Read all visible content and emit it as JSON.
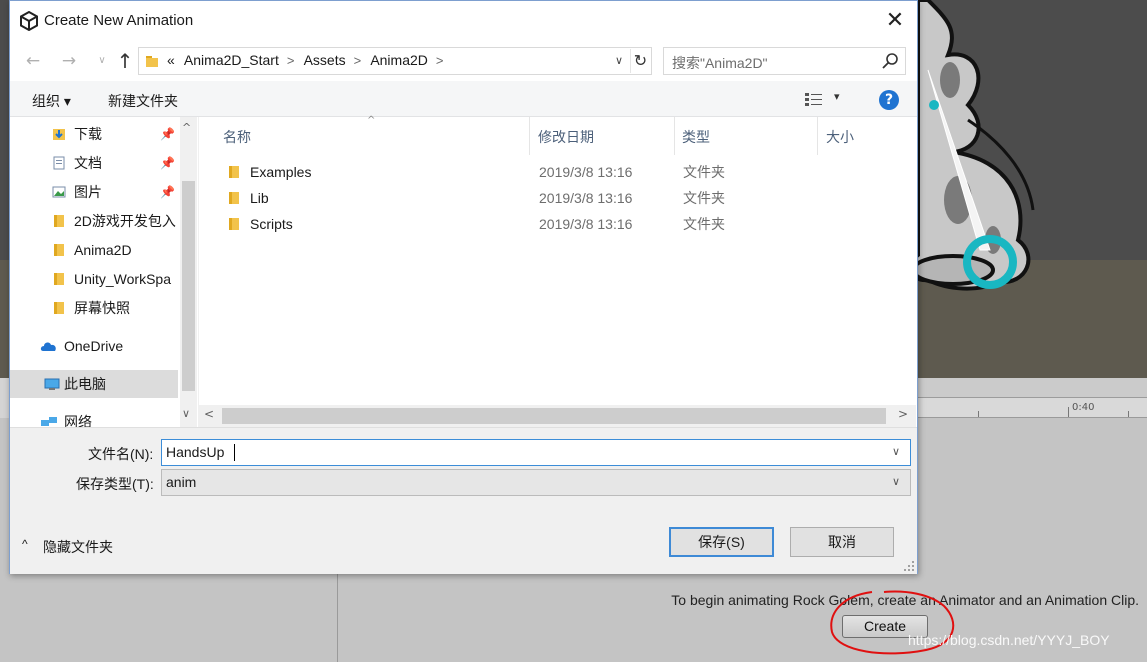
{
  "dialog": {
    "title": "Create New Animation",
    "close_glyph": "✕",
    "nav": {
      "back_glyph": "←",
      "forward_glyph": "→",
      "dropdown_glyph": "∨",
      "up_glyph": "↑",
      "breadcrumb_prefix": "«",
      "breadcrumb": [
        "Anima2D_Start",
        "Assets",
        "Anima2D"
      ],
      "breadcrumb_sep": ">",
      "address_dropdown_glyph": "∨",
      "refresh_glyph": "↻",
      "search_placeholder": "搜索\"Anima2D\""
    },
    "toolbar": {
      "organize_label": "组织 ▾",
      "new_folder_label": "新建文件夹",
      "view_dropdown_glyph": "▾",
      "help_glyph": "?"
    },
    "sidebar": {
      "items": [
        {
          "label": "下载",
          "icon": "download-folder-icon",
          "pinned": true
        },
        {
          "label": "文档",
          "icon": "documents-icon",
          "pinned": true
        },
        {
          "label": "图片",
          "icon": "pictures-icon",
          "pinned": true
        },
        {
          "label": "2D游戏开发包入",
          "icon": "folder-icon",
          "pinned": false
        },
        {
          "label": "Anima2D",
          "icon": "folder-icon",
          "pinned": false
        },
        {
          "label": "Unity_WorkSpa",
          "icon": "folder-icon",
          "pinned": false
        },
        {
          "label": "屏幕快照",
          "icon": "folder-icon",
          "pinned": false
        },
        {
          "label": "OneDrive",
          "icon": "onedrive-icon",
          "pinned": false
        },
        {
          "label": "此电脑",
          "icon": "computer-icon",
          "pinned": false,
          "selected": true
        },
        {
          "label": "网络",
          "icon": "network-icon",
          "pinned": false
        }
      ],
      "pin_glyph": "📌",
      "scroll_up_glyph": "^",
      "scroll_down_glyph": "∨"
    },
    "columns": {
      "name": "名称",
      "modified": "修改日期",
      "type": "类型",
      "size": "大小",
      "sort_glyph": "^"
    },
    "files": [
      {
        "name": "Examples",
        "modified": "2019/3/8 13:16",
        "type": "文件夹"
      },
      {
        "name": "Lib",
        "modified": "2019/3/8 13:16",
        "type": "文件夹"
      },
      {
        "name": "Scripts",
        "modified": "2019/3/8 13:16",
        "type": "文件夹"
      }
    ],
    "hscroll": {
      "left_glyph": "<",
      "right_glyph": ">"
    },
    "form": {
      "filename_label": "文件名(N):",
      "filename_value": "HandsUp",
      "filetype_label": "保存类型(T):",
      "filetype_value": "anim",
      "dropdown_glyph": "∨",
      "hide_folders_caret": "^",
      "hide_folders_label": "隐藏文件夹",
      "save_label": "保存(S)",
      "cancel_label": "取消"
    }
  },
  "unity": {
    "timeline_label": "0:40",
    "hint": "To begin animating Rock Golem, create an Animator and an Animation Clip.",
    "create_label": "Create",
    "watermark": "https://blog.csdn.net/YYYJ_BOY"
  },
  "colors": {
    "accent": "#3e8ad6",
    "help_blue": "#1f73d1",
    "folder_yellow": "#f2c34b",
    "teal_handle": "#19b7c2",
    "annotation_red": "#e01010"
  }
}
